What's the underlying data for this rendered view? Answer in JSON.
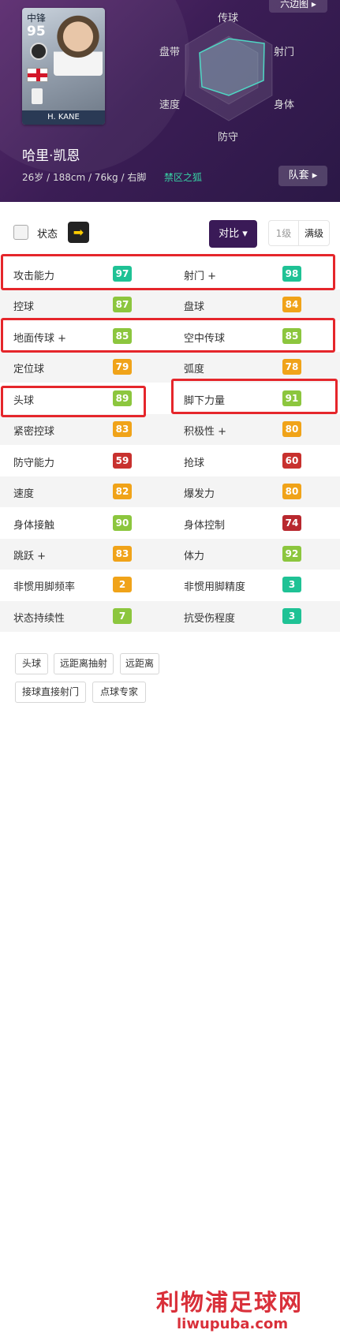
{
  "player": {
    "position": "中锋",
    "overall": "95",
    "card_name": "H. KANE",
    "name": "哈里·凯恩",
    "info": "26岁 / 188cm / 76kg / 右脚",
    "club_tag": "禁区之狐"
  },
  "buttons": {
    "hexagon": "六边图 ▸",
    "squad": "队套 ▸",
    "compare": "对比 ▾",
    "level_1": "1级",
    "level_max": "满级"
  },
  "radar": {
    "labels": {
      "top": "传球",
      "upper_right": "射门",
      "lower_right": "身体",
      "bottom": "防守",
      "lower_left": "速度",
      "upper_left": "盘带"
    }
  },
  "status": {
    "label": "状态",
    "arrow": "➡"
  },
  "stats": [
    {
      "l_label": "攻击能力",
      "l_val": "97",
      "l_color": "#1fc295",
      "r_label": "射门 +",
      "r_val": "98",
      "r_color": "#1fc295"
    },
    {
      "l_label": "控球",
      "l_val": "87",
      "l_color": "#8cc63e",
      "r_label": "盘球",
      "r_val": "84",
      "r_color": "#f0a319"
    },
    {
      "l_label": "地面传球 +",
      "l_val": "85",
      "l_color": "#8cc63e",
      "r_label": "空中传球",
      "r_val": "85",
      "r_color": "#8cc63e"
    },
    {
      "l_label": "定位球",
      "l_val": "79",
      "l_color": "#f0a319",
      "r_label": "弧度",
      "r_val": "78",
      "r_color": "#f0a319"
    },
    {
      "l_label": "头球",
      "l_val": "89",
      "l_color": "#8cc63e",
      "r_label": "脚下力量",
      "r_val": "91",
      "r_color": "#8cc63e"
    },
    {
      "l_label": "紧密控球",
      "l_val": "83",
      "l_color": "#f0a319",
      "r_label": "积极性 +",
      "r_val": "80",
      "r_color": "#f0a319"
    },
    {
      "l_label": "防守能力",
      "l_val": "59",
      "l_color": "#c8312e",
      "r_label": "抢球",
      "r_val": "60",
      "r_color": "#c8312e"
    },
    {
      "l_label": "速度",
      "l_val": "82",
      "l_color": "#f0a319",
      "r_label": "爆发力",
      "r_val": "80",
      "r_color": "#f0a319"
    },
    {
      "l_label": "身体接触",
      "l_val": "90",
      "l_color": "#8cc63e",
      "r_label": "身体控制",
      "r_val": "74",
      "r_color": "#b8282e"
    },
    {
      "l_label": "跳跃 +",
      "l_val": "83",
      "l_color": "#f0a319",
      "r_label": "体力",
      "r_val": "92",
      "r_color": "#8cc63e"
    },
    {
      "l_label": "非惯用脚频率",
      "l_val": "2",
      "l_color": "#f0a319",
      "r_label": "非惯用脚精度",
      "r_val": "3",
      "r_color": "#1fc295"
    },
    {
      "l_label": "状态持续性",
      "l_val": "7",
      "l_color": "#8cc63e",
      "r_label": "抗受伤程度",
      "r_val": "3",
      "r_color": "#1fc295"
    }
  ],
  "skills": [
    "头球",
    "远距离抽射",
    "远距离",
    "接球直接射门",
    "点球专家"
  ],
  "watermark": {
    "title": "利物浦足球网",
    "url": "liwupuba.com"
  }
}
